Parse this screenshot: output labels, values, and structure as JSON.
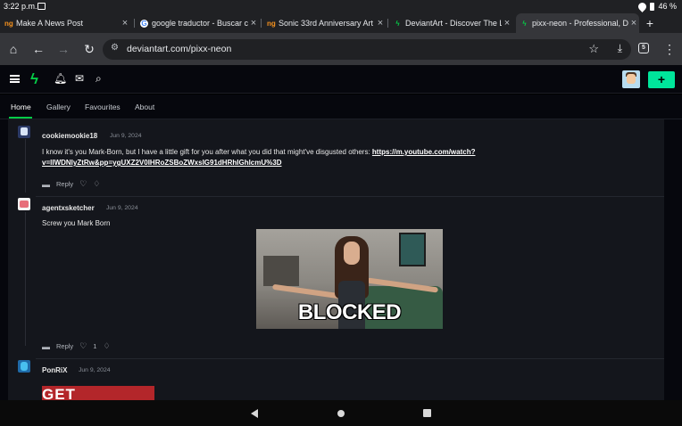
{
  "status_bar": {
    "time": "3:22 p.m.",
    "battery": "46 %"
  },
  "tabs": [
    {
      "title": "Make A News Post",
      "favicon": "ng"
    },
    {
      "title": "google traductor - Buscar c",
      "favicon": "G"
    },
    {
      "title": "Sonic 33rd Anniversary Art",
      "favicon": "ng"
    },
    {
      "title": "DeviantArt - Discover The La",
      "favicon": "da"
    },
    {
      "title": "pixx-neon - Professional, Dg",
      "favicon": "da"
    }
  ],
  "toolbar": {
    "url": "deviantart.com/pixx-neon",
    "tab_count": "5"
  },
  "site_nav": {
    "items": [
      "Home",
      "Gallery",
      "Favourites",
      "About"
    ],
    "active": "Home"
  },
  "comments": [
    {
      "user": "cookiemookie18",
      "date": "Jun 9, 2024",
      "text": "I know it's you Mark-Born, but I have a little gift for you after what you did that might've disgusted others:",
      "link_line1": "https://m.youtube.com/watch?",
      "link_line2": "v=lIWDNlyZtRw&pp=ygUXZ2V0IHRoZSBoZWxsIG91dHRhIGhlcmU%3D",
      "reply_label": "Reply"
    },
    {
      "user": "agentxsketcher",
      "date": "Jun 9, 2024",
      "text": "Screw you Mark Born",
      "gif_caption": "BLOCKED",
      "reply_label": "Reply",
      "likes": "1"
    },
    {
      "user": "PonRiX",
      "date": "Jun 9, 2024",
      "image_text": "GET"
    }
  ],
  "icons": {
    "home": "home-icon",
    "back": "arrow-left-icon",
    "forward": "arrow-right-icon",
    "reload": "reload-icon",
    "star": "star-icon",
    "download": "download-icon",
    "menu": "kebab-menu-icon"
  },
  "colors": {
    "accent": "#05cc47",
    "create_button": "#00e59b"
  }
}
